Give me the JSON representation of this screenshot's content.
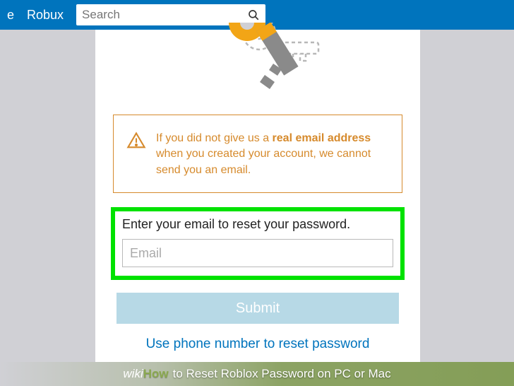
{
  "nav": {
    "link_partial_e": "e",
    "link_robux": "Robux"
  },
  "search": {
    "placeholder": "Search"
  },
  "panel": {
    "info": {
      "prefix": "If you did not give us a ",
      "bold": "real email address",
      "suffix": " when you created your account, we cannot send you an email."
    },
    "prompt": "Enter your email to reset your password.",
    "email_placeholder": "Email",
    "submit": "Submit",
    "alt_link": "Use phone number to reset password"
  },
  "watermark": {
    "brand1": "wiki",
    "brand2": "How",
    "title": " to Reset Roblox Password on PC or Mac"
  }
}
